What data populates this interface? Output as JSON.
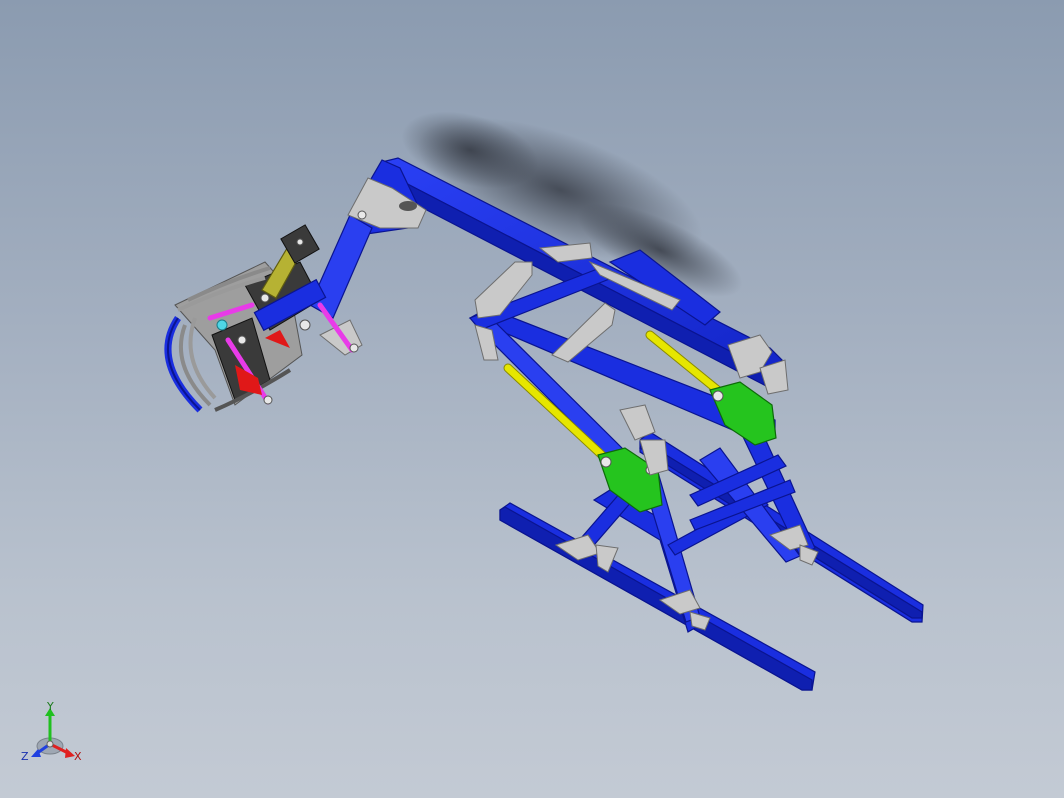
{
  "colors": {
    "frame": "#1a2ee0",
    "gusset": "#c9c9c9",
    "bracket": "#25c41e",
    "hydraulic_rod": "#e6e600",
    "link": "#e83be8",
    "axis_x": "#e02020",
    "axis_y": "#20c020",
    "axis_z": "#2040e0"
  },
  "view_triad": {
    "x_label": "X",
    "y_label": "Y",
    "z_label": "Z"
  },
  "icons": [
    "view-triad-icon"
  ]
}
